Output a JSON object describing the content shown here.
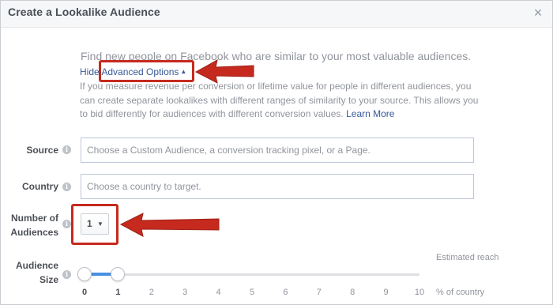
{
  "dialog": {
    "title": "Create a Lookalike Audience",
    "close_glyph": "×"
  },
  "intro": {
    "text": "Find new people on Facebook who are similar to your most valuable audiences.",
    "hide_link": "Hide Advanced Options",
    "hide_caret": "▲",
    "description": "If you measure revenue per conversion or lifetime value for people in different audiences, you can create separate lookalikes with different ranges of similarity to your source. This allows you to bid differently for audiences with different conversion values.",
    "learn_more": "Learn More"
  },
  "form": {
    "source_label": "Source",
    "source_placeholder": "Choose a Custom Audience, a conversion tracking pixel, or a Page.",
    "country_label": "Country",
    "country_placeholder": "Choose a country to target.",
    "num_audiences_label_line1": "Number of",
    "num_audiences_label_line2": "Audiences",
    "num_audiences_value": "1",
    "audience_size_label_line1": "Audience",
    "audience_size_label_line2": "Size",
    "estimated_reach_label": "Estimated reach",
    "percent_label": "% of country",
    "size_ticks": [
      "0",
      "1",
      "2",
      "3",
      "4",
      "5",
      "6",
      "7",
      "8",
      "9",
      "10"
    ],
    "size_range": {
      "min": 0,
      "max": 10,
      "start": 0,
      "end": 1
    }
  },
  "icons": {
    "info": "i",
    "chevron": "▼"
  },
  "colors": {
    "annotation_red": "#c62a1e",
    "link_blue": "#365899",
    "slider_blue": "#4a90e2"
  }
}
